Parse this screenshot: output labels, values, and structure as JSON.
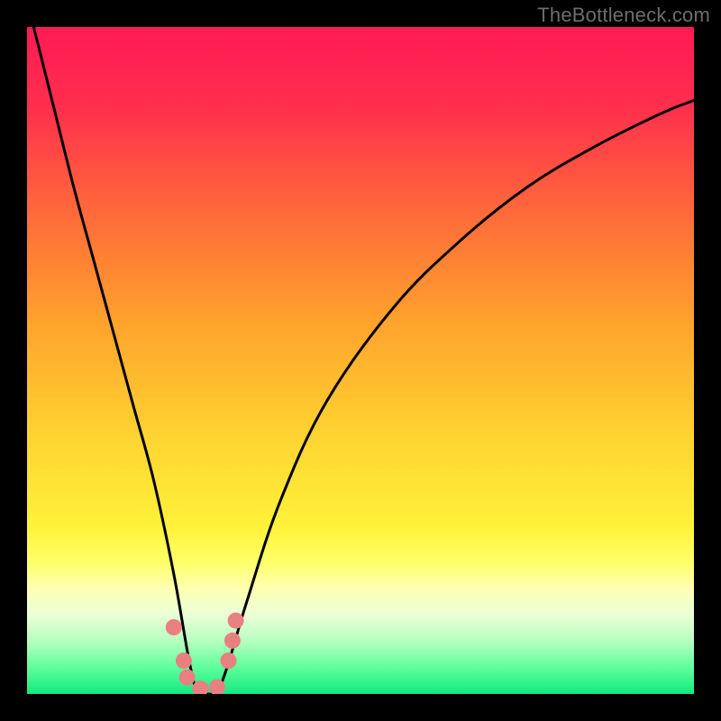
{
  "watermark": "TheBottleneck.com",
  "chart_data": {
    "type": "line",
    "title": "",
    "xlabel": "",
    "ylabel": "",
    "xlim": [
      0,
      100
    ],
    "ylim": [
      0,
      100
    ],
    "gradient_stops": [
      {
        "pct": 0,
        "color": "#ff1a55"
      },
      {
        "pct": 12,
        "color": "#ff2f4d"
      },
      {
        "pct": 28,
        "color": "#ff6a3a"
      },
      {
        "pct": 45,
        "color": "#ffa52c"
      },
      {
        "pct": 62,
        "color": "#ffd531"
      },
      {
        "pct": 75,
        "color": "#fff23a"
      },
      {
        "pct": 80,
        "color": "#ffff66"
      },
      {
        "pct": 84,
        "color": "#ffffb0"
      },
      {
        "pct": 88,
        "color": "#ecffd6"
      },
      {
        "pct": 92,
        "color": "#b8ffbf"
      },
      {
        "pct": 96,
        "color": "#5fff9c"
      },
      {
        "pct": 100,
        "color": "#14e97f"
      }
    ],
    "series": [
      {
        "name": "bottleneck-curve",
        "x": [
          1,
          4,
          7,
          10,
          13,
          16,
          19,
          22,
          24.3,
          25.5,
          27,
          28.5,
          30,
          33,
          38,
          45,
          55,
          65,
          75,
          85,
          95,
          100
        ],
        "y": [
          100,
          88,
          76,
          65,
          54,
          43,
          32,
          18,
          5,
          0.5,
          0,
          0.5,
          4,
          14,
          29,
          44,
          58,
          68,
          76,
          82,
          87,
          89
        ]
      }
    ],
    "markers": [
      {
        "x": 22.0,
        "y": 10.0
      },
      {
        "x": 23.5,
        "y": 5.0
      },
      {
        "x": 24.0,
        "y": 2.5
      },
      {
        "x": 26.0,
        "y": 0.8
      },
      {
        "x": 28.5,
        "y": 1.0
      },
      {
        "x": 30.2,
        "y": 5.0
      },
      {
        "x": 30.8,
        "y": 8.0
      },
      {
        "x": 31.3,
        "y": 11.0
      }
    ],
    "marker_color": "#e98080",
    "curve_color": "#000000"
  }
}
